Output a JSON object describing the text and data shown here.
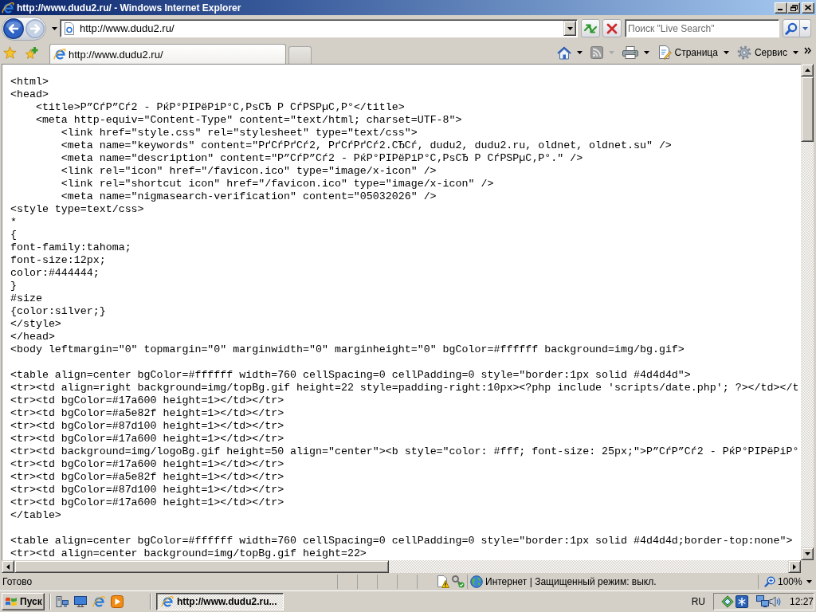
{
  "window": {
    "title": "http://www.dudu2.ru/ - Windows Internet Explorer"
  },
  "navigation": {
    "buttons": [
      {
        "kind": "back",
        "disabled": false
      },
      {
        "kind": "forward",
        "disabled": true
      }
    ],
    "address": "http://www.dudu2.ru/",
    "search": {
      "placeholder": "Поиск \"Live Search\""
    }
  },
  "tabs": [
    {
      "label": "http://www.dudu2.ru/",
      "selected": true
    }
  ],
  "command_bar": [
    {
      "kind": "home",
      "disabled": false
    },
    {
      "kind": "feeds",
      "disabled": true
    },
    {
      "kind": "print",
      "disabled": false
    },
    {
      "kind": "page",
      "label": "Страница",
      "disabled": false
    },
    {
      "kind": "tools",
      "label": "Сервис",
      "disabled": false
    }
  ],
  "source_view": {
    "blocks": [
      {
        "lines": [
          {
            "text": "<html>"
          },
          {
            "text": "<head>",
            "children": [
              {
                "text": "<title>Р”СѓР”Сѓ2 - РќР°РІРёРіР°С‚РѕСЂ Р СѓРЅРµС‚Р°</title>"
              },
              {
                "text": "<meta http-equiv=\"Content-Type\" content=\"text/html; charset=UTF-8\">",
                "children": [
                  {
                    "text": "<link href=\"style.css\" rel=\"stylesheet\" type=\"text/css\">"
                  },
                  {
                    "text": "<meta name=\"keywords\" content=\"РґСѓРґСѓ2, РґСѓРґСѓ2.СЂСѓ, dudu2, dudu2.ru, oldnet, oldnet.su\" />"
                  },
                  {
                    "text": "<meta name=\"description\" content=\"Р”СѓР”Сѓ2 - РќР°РІРёРіР°С‚РѕСЂ Р СѓРЅРµС‚Р°.\" />"
                  },
                  {
                    "text": "<link rel=\"icon\" href=\"/favicon.ico\" type=\"image/x-icon\" />"
                  },
                  {
                    "text": "<link rel=\"shortcut icon\" href=\"/favicon.ico\" type=\"image/x-icon\" />"
                  },
                  {
                    "text": "<meta name=\"nigmasearch-verification\" content=\"05032026\" />"
                  }
                ]
              }
            ]
          },
          {
            "text": "<style type=text/css>"
          },
          {
            "text": "*"
          },
          {
            "text": "{"
          },
          {
            "text": "font-family:tahoma;"
          },
          {
            "text": "font-size:12px;"
          },
          {
            "text": "color:#444444;"
          },
          {
            "text": "}"
          },
          {
            "text": "#size"
          },
          {
            "text": "{color:silver;}"
          },
          {
            "text": "</style>"
          },
          {
            "text": "</head>"
          },
          {
            "text": "<body leftmargin=\"0\" topmargin=\"0\" marginwidth=\"0\" marginheight=\"0\" bgColor=#ffffff background=img/bg.gif>"
          }
        ]
      },
      {
        "lines": [
          {
            "text": "<table align=center bgColor=#ffffff width=760 cellSpacing=0 cellPadding=0 style=\"border:1px solid #4d4d4d\">"
          },
          {
            "text": "<tr><td align=right background=img/topBg.gif height=22 style=padding-right:10px><?php include 'scripts/date.php'; ?></td></t"
          },
          {
            "text": "<tr><td bgColor=#17a600 height=1></td></tr>"
          },
          {
            "text": "<tr><td bgColor=#a5e82f height=1></td></tr>"
          },
          {
            "text": "<tr><td bgColor=#87d100 height=1></td></tr>"
          },
          {
            "text": "<tr><td bgColor=#17a600 height=1></td></tr>"
          },
          {
            "text": "<tr><td background=img/logoBg.gif height=50 align=\"center\"><b style=\"color: #fff; font-size: 25px;\">Р”СѓР”Сѓ2 - РќР°РІРёРіР°"
          },
          {
            "text": "<tr><td bgColor=#17a600 height=1></td></tr>"
          },
          {
            "text": "<tr><td bgColor=#a5e82f height=1></td></tr>"
          },
          {
            "text": "<tr><td bgColor=#87d100 height=1></td></tr>"
          },
          {
            "text": "<tr><td bgColor=#17a600 height=1></td></tr>"
          },
          {
            "text": "</table>"
          }
        ]
      },
      {
        "lines": [
          {
            "text": "<table align=center bgColor=#ffffff width=760 cellSpacing=0 cellPadding=0 style=\"border:1px solid #4d4d4d;border-top:none\">"
          },
          {
            "text": "<tr><td align=center background=img/topBg.gif height=22>"
          }
        ]
      }
    ]
  },
  "status_bar": {
    "text": "Готово",
    "zone": "Интернет | Защищенный режим: выкл.",
    "zoom": "100%"
  },
  "taskbar": {
    "start": "Пуск",
    "tasks": [
      {
        "label": "http://www.dudu2.ru...",
        "selected": true
      }
    ],
    "language": "RU",
    "clock": "12:27"
  }
}
